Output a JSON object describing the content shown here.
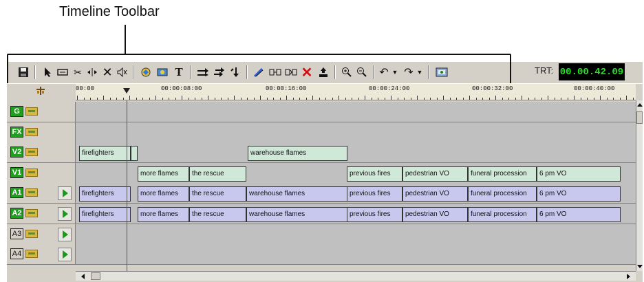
{
  "callout": {
    "label": "Timeline Toolbar"
  },
  "toolbar": {
    "trt_label": "TRT:",
    "trt_value": "00.00.42.09",
    "icons": [
      "save-icon",
      "pointer-icon",
      "ripple-edit-icon",
      "razor-icon",
      "slip-icon",
      "delete-icon",
      "mute-icon",
      "effects-icon",
      "transition-icon",
      "title-icon",
      "insert-icon",
      "overwrite-icon",
      "replace-icon",
      "trim-icon",
      "split-clip-icon",
      "join-clip-icon",
      "clear-icon",
      "lift-icon",
      "zoom-in-icon",
      "zoom-out-icon",
      "undo-icon",
      "redo-icon",
      "settings-icon"
    ]
  },
  "ruler": {
    "labels": [
      "00:00",
      "00:00:08:00",
      "00:00:16:00",
      "00:00:24:00",
      "00:00:32:00",
      "00:00:40:00"
    ]
  },
  "tracks": [
    {
      "id": "G",
      "type": "video",
      "active": true,
      "clips": []
    },
    {
      "id": "FX",
      "type": "video",
      "active": true,
      "clips": []
    },
    {
      "id": "V2",
      "type": "video",
      "active": true,
      "clips": [
        {
          "label": "firefighters"
        },
        {
          "label": ""
        },
        {
          "label": "warehouse flames"
        }
      ]
    },
    {
      "id": "V1",
      "type": "video",
      "active": true,
      "clips": [
        {
          "label": "more flames"
        },
        {
          "label": "the rescue"
        },
        {
          "label": "previous fires"
        },
        {
          "label": "pedestrian VO"
        },
        {
          "label": "funeral procession"
        },
        {
          "label": "6 pm VO"
        }
      ]
    },
    {
      "id": "A1",
      "type": "audio",
      "active": true,
      "clips": [
        {
          "label": "firefighters"
        },
        {
          "label": "more flames"
        },
        {
          "label": "the rescue"
        },
        {
          "label": "warehouse flames"
        },
        {
          "label": "previous fires"
        },
        {
          "label": "pedestrian VO"
        },
        {
          "label": "funeral procession"
        },
        {
          "label": "6 pm VO"
        }
      ]
    },
    {
      "id": "A2",
      "type": "audio",
      "active": true,
      "clips": [
        {
          "label": "firefighters"
        },
        {
          "label": "more flames"
        },
        {
          "label": "the rescue"
        },
        {
          "label": "warehouse flames"
        },
        {
          "label": "previous fires"
        },
        {
          "label": "pedestrian VO"
        },
        {
          "label": "funeral procession"
        },
        {
          "label": "6 pm VO"
        }
      ]
    },
    {
      "id": "A3",
      "type": "audio",
      "active": false,
      "clips": []
    },
    {
      "id": "A4",
      "type": "audio",
      "active": false,
      "clips": []
    }
  ]
}
